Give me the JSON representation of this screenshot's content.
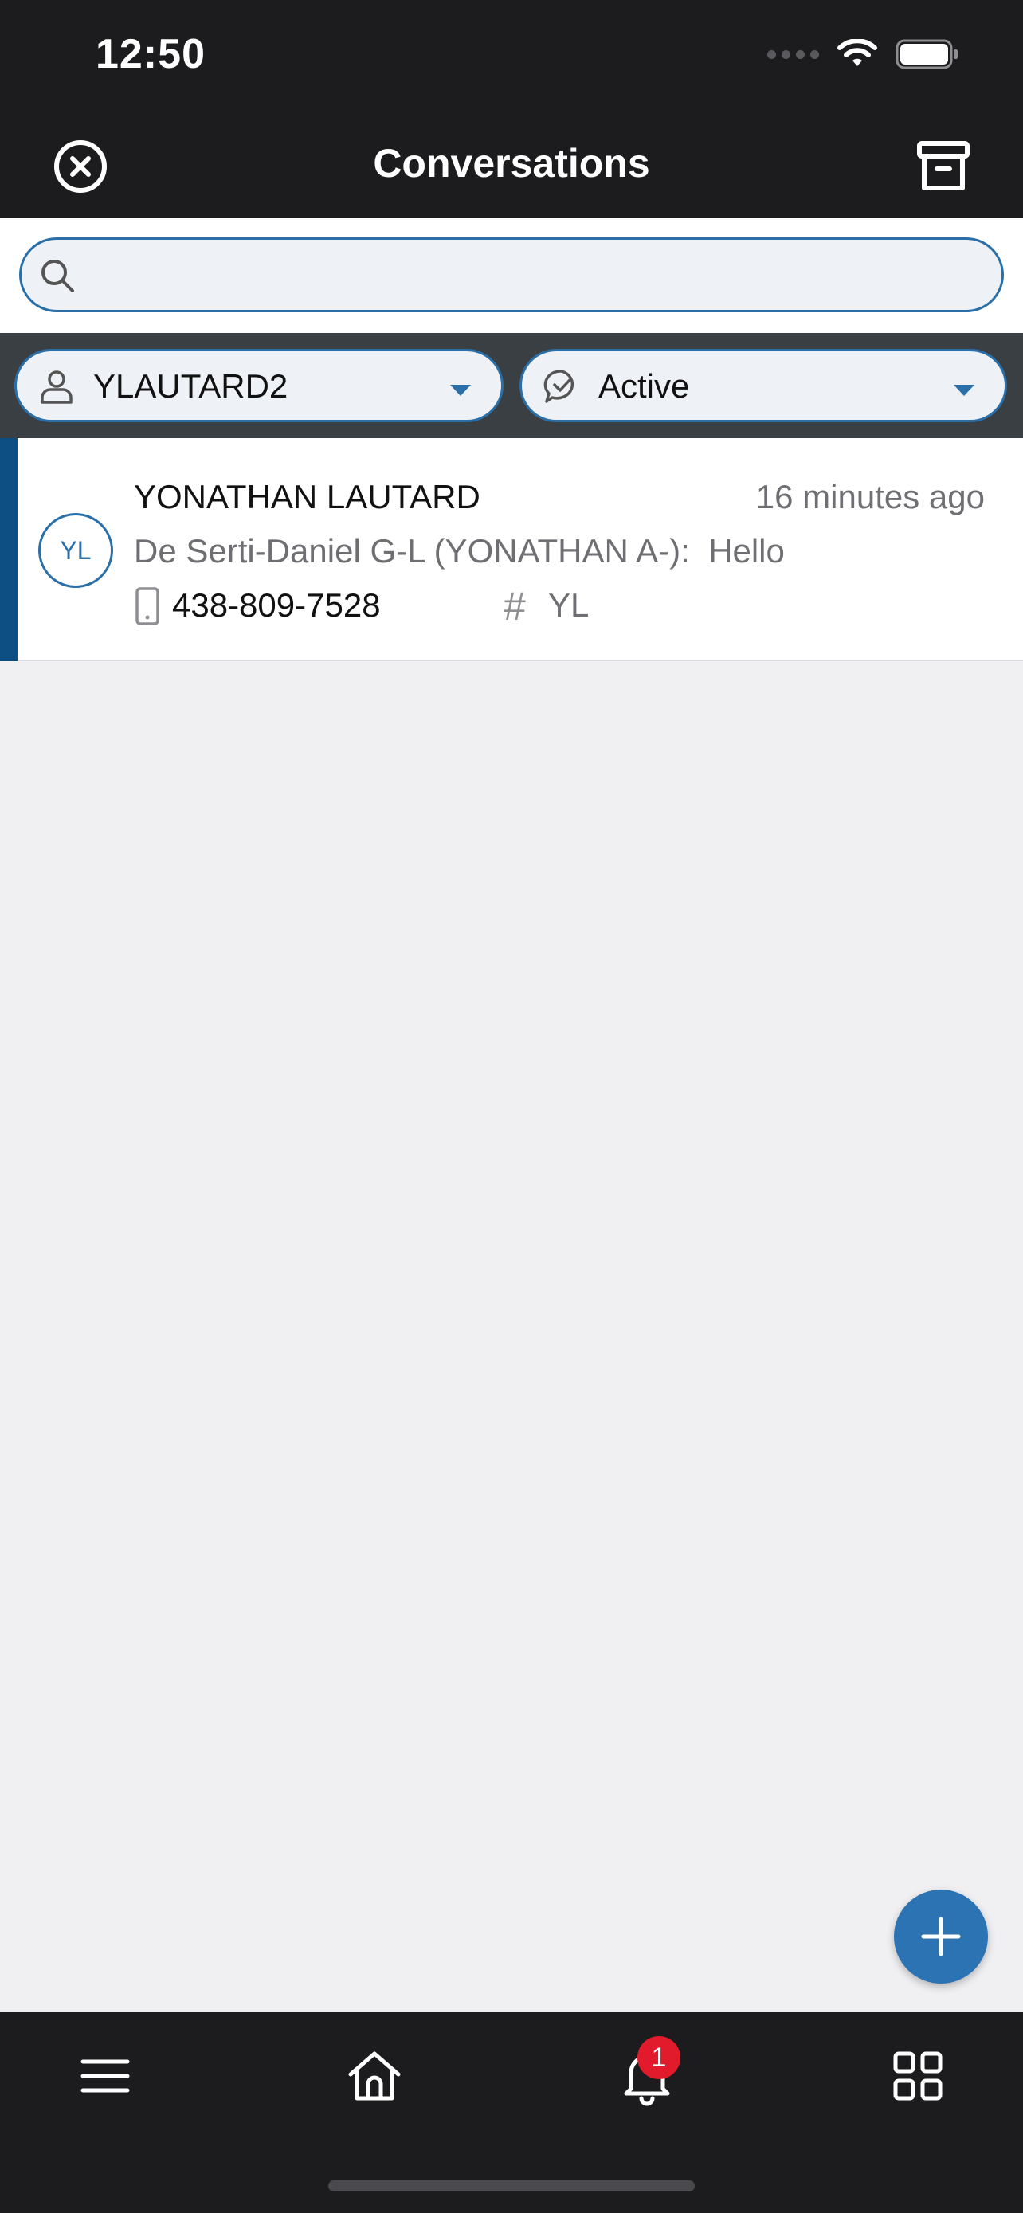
{
  "status_bar": {
    "time": "12:50"
  },
  "header": {
    "title": "Conversations"
  },
  "search": {
    "placeholder": ""
  },
  "filters": {
    "user_label": "YLAUTARD2",
    "status_label": "Active"
  },
  "conversations": [
    {
      "avatar": "YL",
      "name": "YONATHAN LAUTARD",
      "time": "16 minutes ago",
      "preview": "De Serti-Daniel G-L (YONATHAN A-):  Hello",
      "phone": "438-809-7528",
      "tag": "YL"
    }
  ],
  "bottom_nav": {
    "notification_count": "1"
  },
  "colors": {
    "accent": "#2b73b3",
    "dark_bar": "#1c1c1e",
    "badge": "#e11b2b",
    "row_accent": "#0d4f82"
  }
}
